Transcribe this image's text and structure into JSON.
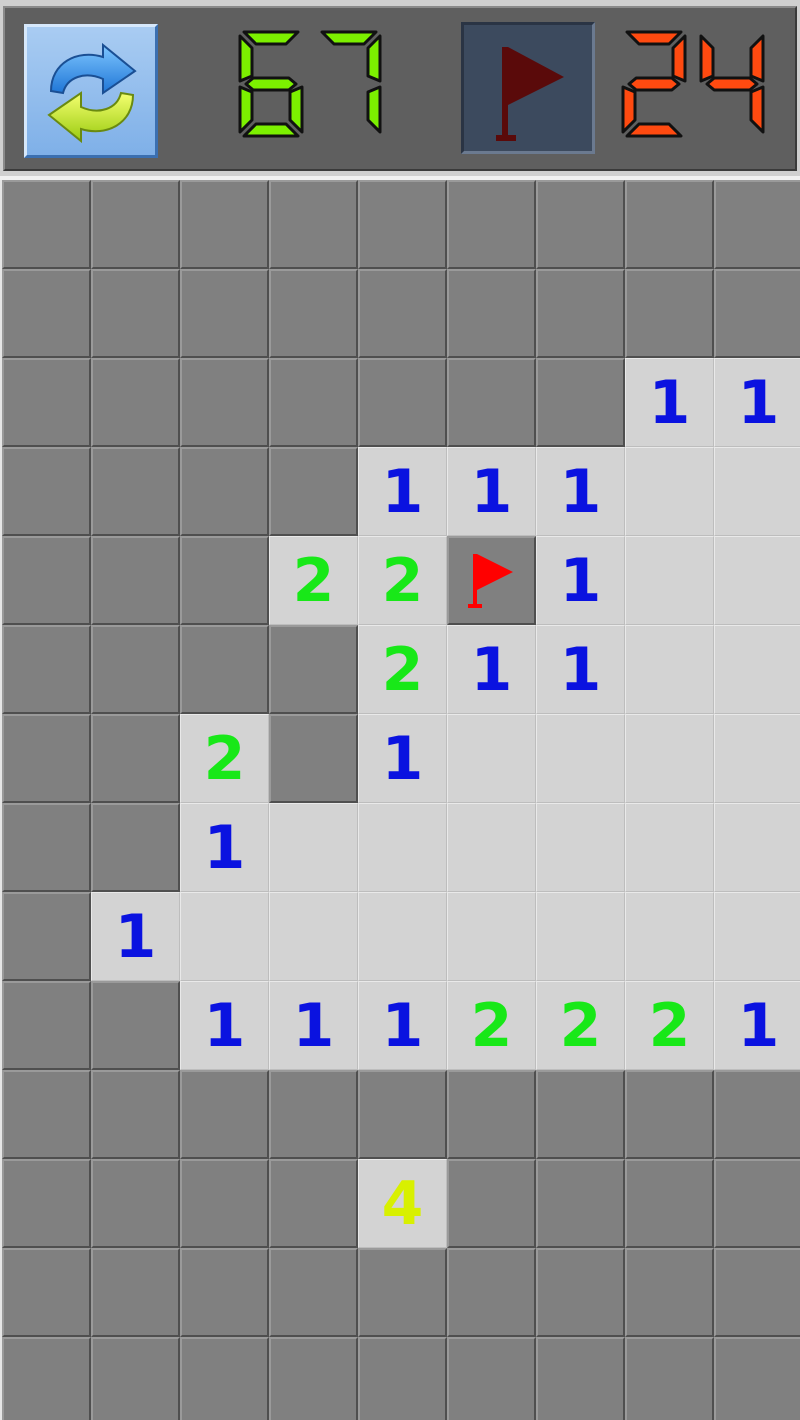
{
  "header": {
    "restart_icon": "refresh-arrows-icon",
    "flag_mode_icon": "flag-icon",
    "timer": "67",
    "mines_remaining": "24",
    "colors": {
      "timer": "#7cf000",
      "mines": "#ff4a10",
      "flag_mode_flag": "#5a0a0a",
      "restart_bg": "#8fbcec"
    }
  },
  "board": {
    "columns": 9,
    "rows": 14,
    "legend": {
      "H": "hidden",
      "F": "flagged",
      "0": "open-empty",
      "1-8": "open-number"
    },
    "grid": [
      [
        "H",
        "H",
        "H",
        "H",
        "H",
        "H",
        "H",
        "H",
        "H"
      ],
      [
        "H",
        "H",
        "H",
        "H",
        "H",
        "H",
        "H",
        "H",
        "H"
      ],
      [
        "H",
        "H",
        "H",
        "H",
        "H",
        "H",
        "H",
        "1",
        "1"
      ],
      [
        "H",
        "H",
        "H",
        "H",
        "1",
        "1",
        "1",
        "0",
        "0"
      ],
      [
        "H",
        "H",
        "H",
        "2",
        "2",
        "F",
        "1",
        "0",
        "0"
      ],
      [
        "H",
        "H",
        "H",
        "H",
        "2",
        "1",
        "1",
        "0",
        "0"
      ],
      [
        "H",
        "H",
        "2",
        "H",
        "1",
        "0",
        "0",
        "0",
        "0"
      ],
      [
        "H",
        "H",
        "1",
        "0",
        "0",
        "0",
        "0",
        "0",
        "0"
      ],
      [
        "H",
        "1",
        "0",
        "0",
        "0",
        "0",
        "0",
        "0",
        "0"
      ],
      [
        "H",
        "H",
        "1",
        "1",
        "1",
        "2",
        "2",
        "2",
        "1"
      ],
      [
        "H",
        "H",
        "H",
        "H",
        "H",
        "H",
        "H",
        "H",
        "H"
      ],
      [
        "H",
        "H",
        "H",
        "H",
        "4",
        "H",
        "H",
        "H",
        "H"
      ],
      [
        "H",
        "H",
        "H",
        "H",
        "H",
        "H",
        "H",
        "H",
        "H"
      ],
      [
        "H",
        "H",
        "H",
        "H",
        "H",
        "H",
        "H",
        "H",
        "H"
      ]
    ],
    "number_colors": {
      "1": "#0a12e0",
      "2": "#18e818",
      "4": "#d8f000"
    },
    "flag_color": "#ff0000"
  }
}
